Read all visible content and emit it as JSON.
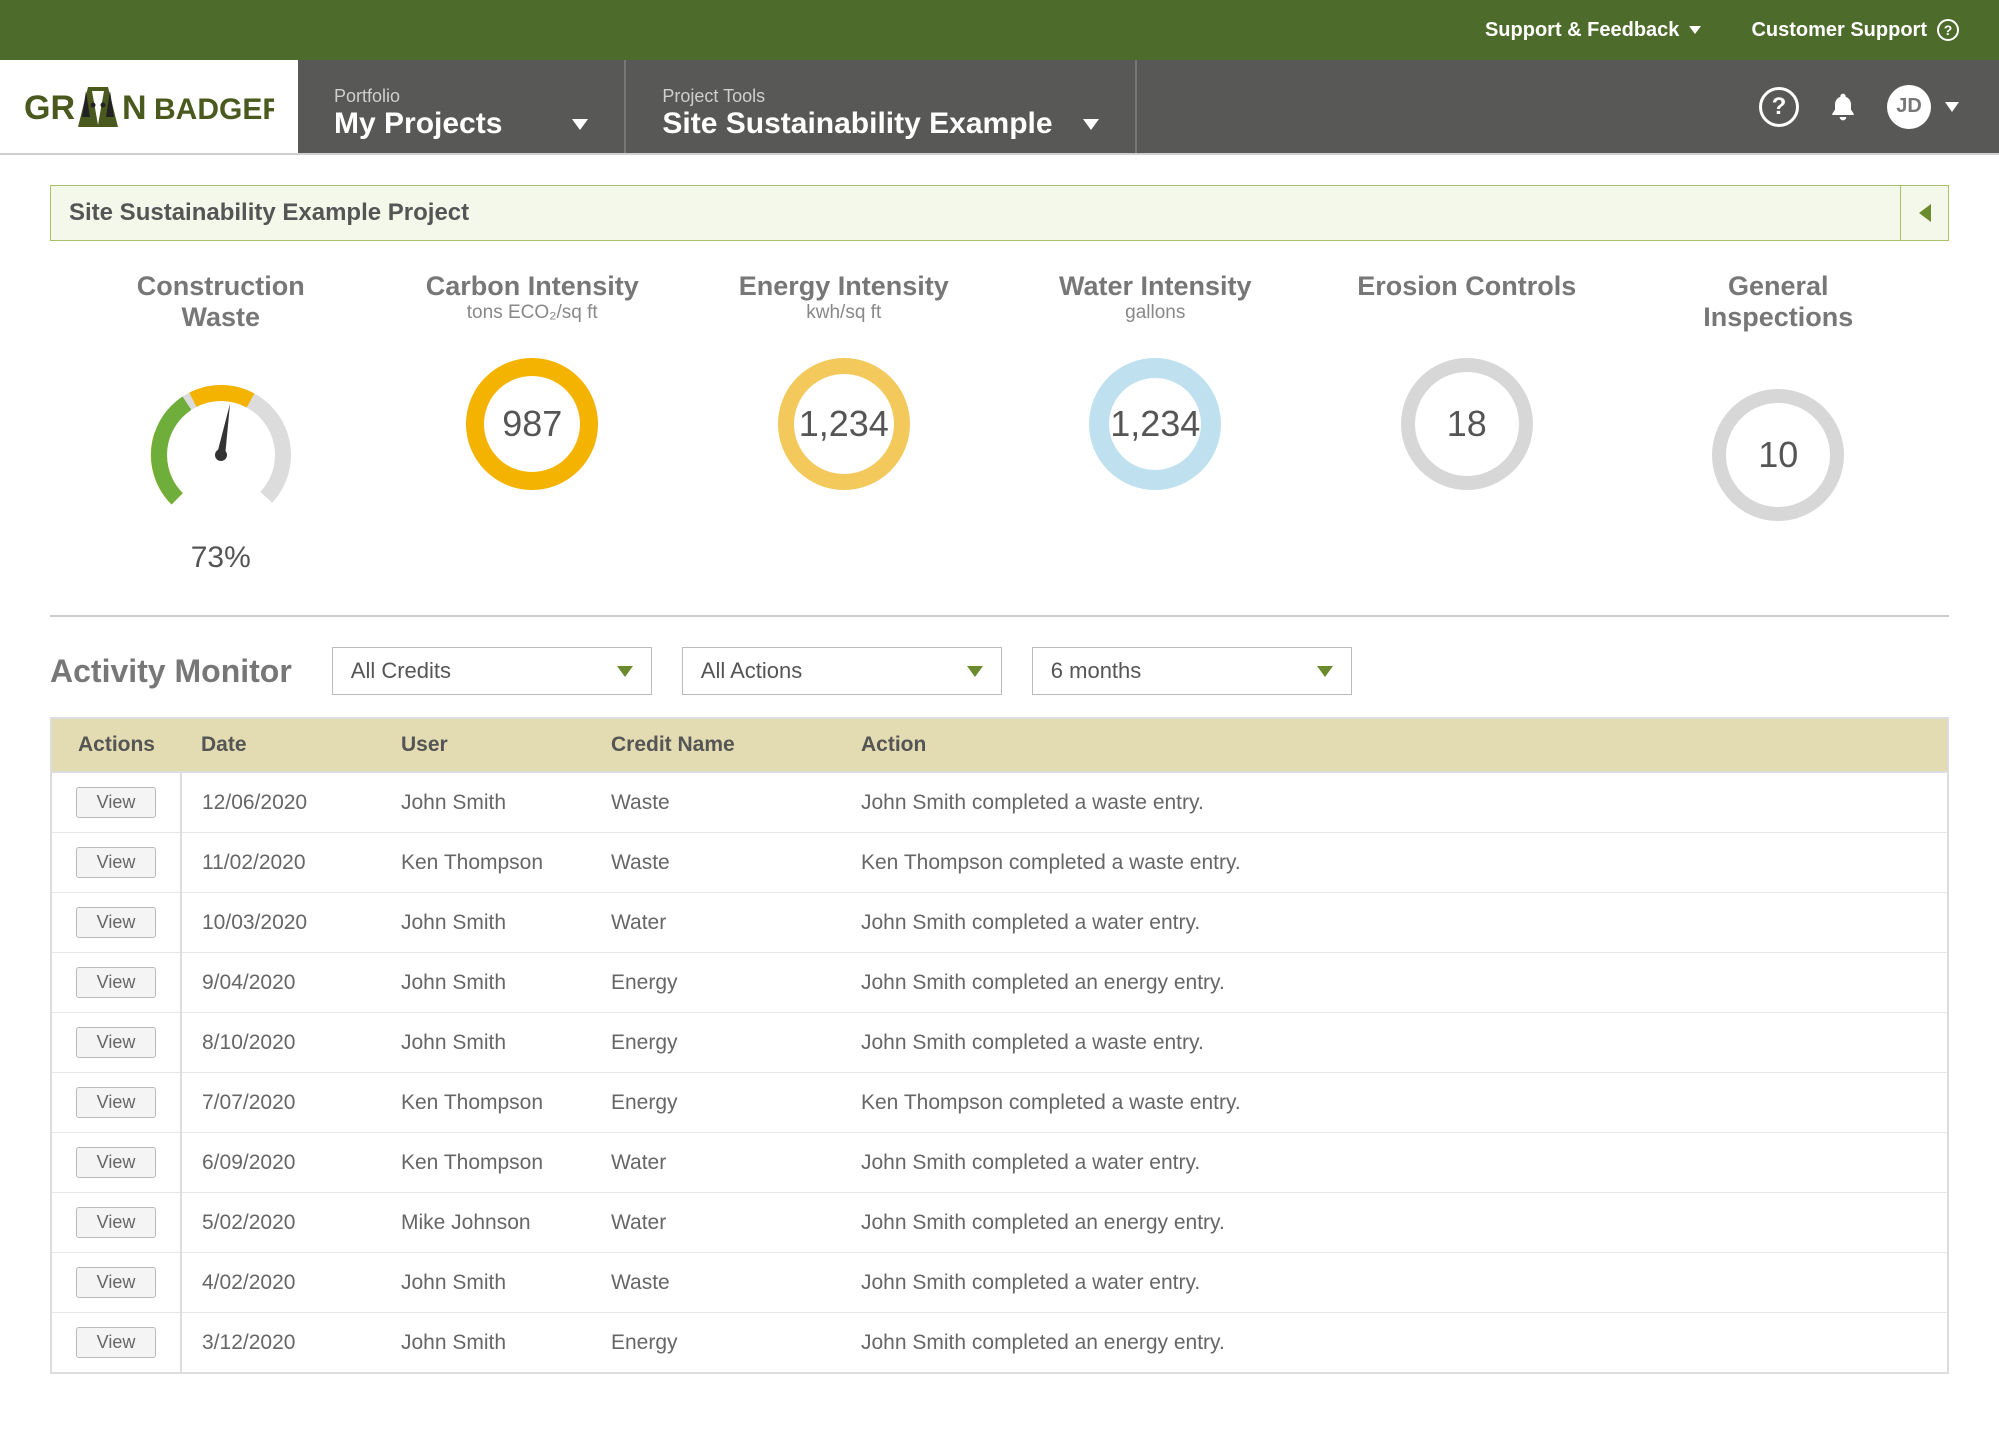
{
  "topbar": {
    "support_feedback": "Support & Feedback",
    "customer_support": "Customer Support"
  },
  "nav": {
    "logo": "GREEN BADGER",
    "portfolio_label": "Portfolio",
    "portfolio_value": "My Projects",
    "tools_label": "Project Tools",
    "tools_value": "Site Sustainability Example",
    "avatar_initials": "JD"
  },
  "page_title": "Site Sustainability Example Project",
  "metrics": [
    {
      "title": "Construction Waste",
      "unit": "",
      "value": "73%",
      "type": "dial"
    },
    {
      "title": "Carbon Intensity",
      "unit": "tons ECO₂/sq ft",
      "value": "987",
      "color": "#f3b300",
      "thickness": 18
    },
    {
      "title": "Energy Intensity",
      "unit": "kwh/sq ft",
      "value": "1,234",
      "color": "#f4c95b",
      "thickness": 16
    },
    {
      "title": "Water Intensity",
      "unit": "gallons",
      "value": "1,234",
      "color": "#bfe0ee",
      "thickness": 20
    },
    {
      "title": "Erosion Controls",
      "unit": "",
      "value": "18",
      "color": "#d7d7d7",
      "thickness": 14
    },
    {
      "title": "General Inspections",
      "unit": "",
      "value": "10",
      "color": "#d7d7d7",
      "thickness": 14
    }
  ],
  "activity": {
    "heading": "Activity Monitor",
    "filters": {
      "credits": "All Credits",
      "actions": "All Actions",
      "range": "6 months"
    },
    "columns": [
      "Actions",
      "Date",
      "User",
      "Credit Name",
      "Action"
    ],
    "view_label": "View",
    "rows": [
      {
        "date": "12/06/2020",
        "user": "John Smith",
        "credit": "Waste",
        "action": "John Smith completed a waste entry."
      },
      {
        "date": "11/02/2020",
        "user": "Ken Thompson",
        "credit": "Waste",
        "action": "Ken Thompson completed a waste entry."
      },
      {
        "date": "10/03/2020",
        "user": "John Smith",
        "credit": "Water",
        "action": "John Smith completed a water entry."
      },
      {
        "date": "9/04/2020",
        "user": "John Smith",
        "credit": "Energy",
        "action": "John Smith completed an energy entry."
      },
      {
        "date": "8/10/2020",
        "user": "John Smith",
        "credit": "Energy",
        "action": "John Smith completed a waste entry."
      },
      {
        "date": "7/07/2020",
        "user": "Ken Thompson",
        "credit": "Energy",
        "action": "Ken Thompson completed a waste entry."
      },
      {
        "date": "6/09/2020",
        "user": "Ken Thompson",
        "credit": "Water",
        "action": "John Smith completed a water entry."
      },
      {
        "date": "5/02/2020",
        "user": "Mike Johnson",
        "credit": "Water",
        "action": "John Smith completed an energy entry."
      },
      {
        "date": "4/02/2020",
        "user": "John Smith",
        "credit": "Waste",
        "action": "John Smith completed a water entry."
      },
      {
        "date": "3/12/2020",
        "user": "John Smith",
        "credit": "Energy",
        "action": "John Smith completed an energy entry."
      }
    ]
  }
}
